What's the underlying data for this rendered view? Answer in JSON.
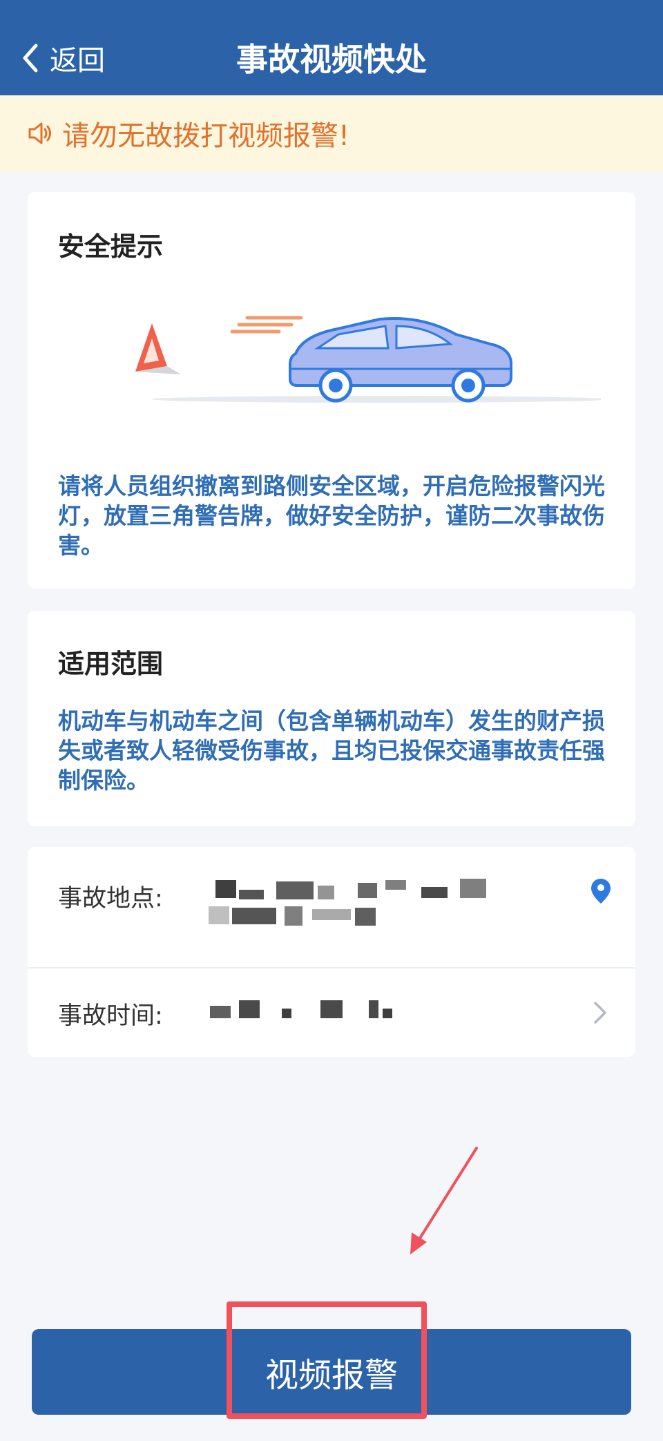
{
  "header": {
    "back_label": "返回",
    "title": "事故视频快处"
  },
  "notice": {
    "text": "请勿无故拨打视频报警!"
  },
  "safety": {
    "title": "安全提示",
    "text": "请将人员组织撤离到路侧安全区域，开启危险报警闪光灯，放置三角警告牌，做好安全防护，谨防二次事故伤害。"
  },
  "scope": {
    "title": "适用范围",
    "text": "机动车与机动车之间（包含单辆机动车）发生的财产损失或者致人轻微受伤事故，且均已投保交通事故责任强制保险。"
  },
  "form": {
    "location_label": "事故地点:",
    "time_label": "事故时间:"
  },
  "cta": {
    "label": "视频报警"
  },
  "colors": {
    "primary": "#2c63a8",
    "notice_bg": "#fdf7df",
    "notice_text": "#e2712c",
    "info_text": "#2f6db5",
    "highlight": "#f0515a"
  }
}
